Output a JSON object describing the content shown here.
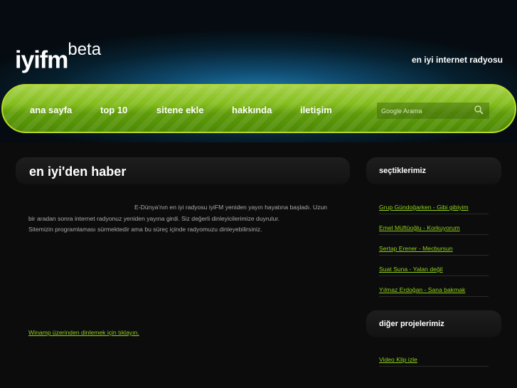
{
  "header": {
    "logo": "iyifm",
    "logo_sup": "beta",
    "tagline": "en iyi internet radyosu"
  },
  "nav": {
    "items": [
      "ana sayfa",
      "top 10",
      "sitene ekle",
      "hakkında",
      "iletişim"
    ],
    "search_placeholder": "Google Arama"
  },
  "main": {
    "title": "en iyi'den haber",
    "lines": [
      "E-Dünya'nın en iyi radyosu iyiFM yeniden yayın hayatına başladı. Uzun",
      "bir aradan sonra internet radyonuz yeniden yayına girdi. Siz değerli dinleyicilerimize duyrulur.",
      "Sitemizin programlaması sürmektedir ama bu süreç içinde radyomuzu dinleyebilirsiniz."
    ],
    "winamp_link": "Winamp üzerinden dinlemek için tıklayın."
  },
  "sidebar": {
    "picks_title": "seçtiklerimiz",
    "picks": [
      "Grup Gündoğarken - Gibi gibiyim",
      "Emel Müftüoğlu - Korkuyorum",
      "Sertap Erener - Mecbursun",
      "Suat Suna - Yalan değil",
      "Yılmaz Erdoğan - Sana bakmak"
    ],
    "projects_title": "diğer projelerimiz",
    "projects": [
      "Video Klip izle"
    ]
  }
}
